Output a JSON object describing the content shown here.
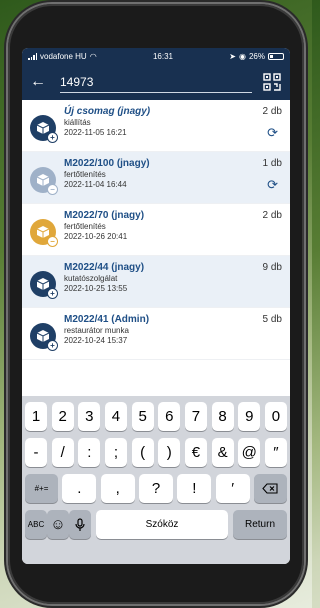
{
  "status": {
    "carrier": "vodafone HU",
    "time": "16:31",
    "battery": "26%"
  },
  "header": {
    "search_value": "14973"
  },
  "items": [
    {
      "title": "Új csomag (jnagy)",
      "sub": "kiállítás",
      "date": "2022-11-05 16:21",
      "count": "2 db",
      "sync": true,
      "italic": true,
      "color": "#1f3f66",
      "badge": "+"
    },
    {
      "title": "M2022/100 (jnagy)",
      "sub": "fertőtlenítés",
      "date": "2022-11-04 16:44",
      "count": "1 db",
      "sync": true,
      "italic": false,
      "color": "#9fb1c8",
      "badge": "−"
    },
    {
      "title": "M2022/70 (jnagy)",
      "sub": "fertőtlenítés",
      "date": "2022-10-26 20:41",
      "count": "2 db",
      "sync": false,
      "italic": false,
      "color": "#e0a73a",
      "badge": "−"
    },
    {
      "title": "M2022/44 (jnagy)",
      "sub": "kutatószolgálat",
      "date": "2022-10-25 13:55",
      "count": "9 db",
      "sync": false,
      "italic": false,
      "color": "#1f3f66",
      "badge": "+"
    },
    {
      "title": "M2022/41 (Admin)",
      "sub": "restaurátor munka",
      "date": "2022-10-24 15:37",
      "count": "5 db",
      "sync": false,
      "italic": false,
      "color": "#1f3f66",
      "badge": "+"
    }
  ],
  "keyboard": {
    "row1": [
      "1",
      "2",
      "3",
      "4",
      "5",
      "6",
      "7",
      "8",
      "9",
      "0"
    ],
    "row2": [
      "-",
      "/",
      ":",
      ";",
      "(",
      ")",
      "€",
      "&",
      "@",
      "″"
    ],
    "row3_left": "#+=",
    "row3_keys": [
      ".",
      ",",
      "?",
      "!",
      "′"
    ],
    "abc": "ABC",
    "space": "Szóköz",
    "return": "Return"
  }
}
